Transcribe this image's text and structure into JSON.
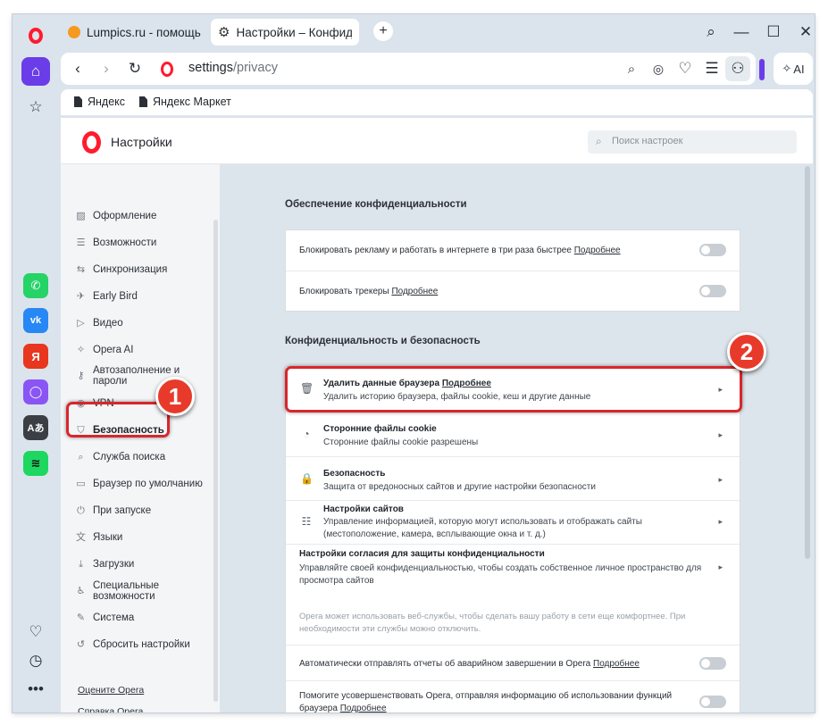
{
  "colors": {
    "opera_red": "#ff1b2d",
    "annotation_red": "#d9262b",
    "badge_red": "#e83a2a"
  },
  "tabs": [
    {
      "title": "Lumpics.ru - помощь с ко",
      "icon": "orange-favicon"
    },
    {
      "title": "Настройки – Конфиденц",
      "icon": "gear-icon"
    }
  ],
  "address": {
    "host": "settings",
    "path": "/privacy"
  },
  "toolbar": {
    "ai_label": "AI"
  },
  "bookmarks": [
    {
      "label": "Яндекс"
    },
    {
      "label": "Яндекс Маркет"
    }
  ],
  "settings": {
    "title": "Настройки",
    "search_placeholder": "Поиск настроек",
    "nav": [
      {
        "label": "Оформление",
        "icon": "image-icon"
      },
      {
        "label": "Возможности",
        "icon": "list-icon"
      },
      {
        "label": "Синхронизация",
        "icon": "sync-icon"
      },
      {
        "label": "Early Bird",
        "icon": "bird-icon"
      },
      {
        "label": "Видео",
        "icon": "play-icon"
      },
      {
        "label": "Opera AI",
        "icon": "sparkle-icon"
      },
      {
        "label": "Автозаполнение и\nпароли",
        "icon": "key-icon"
      },
      {
        "label": "VPN",
        "icon": "vpn-icon"
      },
      {
        "label": "Безопасность",
        "icon": "shield-icon"
      },
      {
        "label": "Служба поиска",
        "icon": "search-icon"
      },
      {
        "label": "Браузер по умолчанию",
        "icon": "browser-icon"
      },
      {
        "label": "При запуске",
        "icon": "power-icon"
      },
      {
        "label": "Языки",
        "icon": "globe-icon"
      },
      {
        "label": "Загрузки",
        "icon": "download-icon"
      },
      {
        "label": "Специальные\nвозможности",
        "icon": "accessibility-icon"
      },
      {
        "label": "Система",
        "icon": "wrench-icon"
      },
      {
        "label": "Сбросить настройки",
        "icon": "reset-icon"
      }
    ],
    "footer_links": [
      "Оцените Opera",
      "Справка Opera"
    ],
    "privacy_section": {
      "title": "Обеспечение конфиденциальности",
      "rows": [
        {
          "text": "Блокировать рекламу и работать в интернете в три раза быстрее",
          "link": "Подробнее",
          "toggle": false
        },
        {
          "text": "Блокировать трекеры",
          "link": "Подробнее",
          "toggle": false
        }
      ]
    },
    "security_section": {
      "title": "Конфиденциальность и безопасность",
      "rows": [
        {
          "title": "Удалить данные браузера",
          "link": "Подробнее",
          "subtitle": "Удалить историю браузера, файлы cookie, кеш и другие данные",
          "icon": "trash-icon"
        },
        {
          "title": "Сторонние файлы cookie",
          "subtitle": "Сторонние файлы cookie разрешены",
          "icon": "cookie-icon"
        },
        {
          "title": "Безопасность",
          "subtitle": "Защита от вредоносных сайтов и другие настройки безопасности",
          "icon": "lock-icon"
        },
        {
          "title": "Настройки сайтов",
          "subtitle": "Управление информацией, которую могут использовать и отображать сайты",
          "subtitle2": "(местоположение, камера, всплывающие окна и т. д.)",
          "icon": "sliders-icon"
        }
      ],
      "consent": {
        "title": "Настройки согласия для защиты конфиденциальности",
        "subtitle": "Управляйте своей конфиденциальностью, чтобы создать собственное личное пространство для",
        "subtitle2": "просмотра сайтов",
        "note": "Opera может использовать веб-службы, чтобы сделать вашу работу в сети еще комфортнее. При",
        "note2": "необходимости эти службы можно отключить."
      },
      "toggle_rows": [
        {
          "text": "Автоматически отправлять отчеты об аварийном завершении в Opera",
          "link": "Подробнее",
          "toggle": false
        },
        {
          "text": "Помогите усовершенствовать Opera, отправляя информацию об использовании функций",
          "text2": "браузера",
          "link": "Подробнее",
          "toggle": false
        }
      ]
    }
  },
  "annotations": {
    "badge1": "1",
    "badge2": "2"
  }
}
